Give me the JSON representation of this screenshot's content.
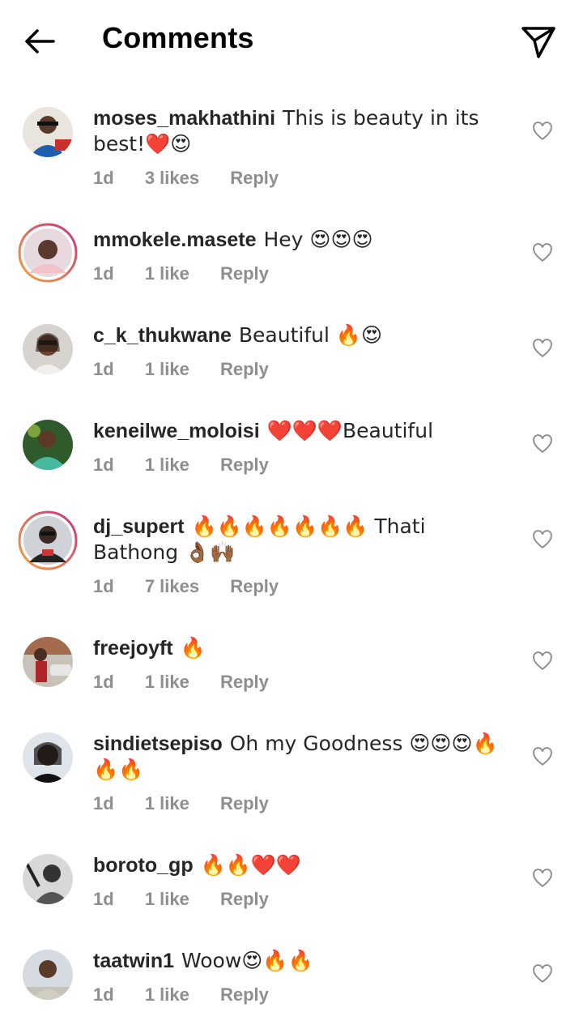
{
  "header": {
    "title": "Comments"
  },
  "comments": [
    {
      "username": "moses_makhathini",
      "text": "This is beauty in its best!❤️😍",
      "time": "1d",
      "likes": "3 likes",
      "reply": "Reply"
    },
    {
      "username": "mmokele.masete",
      "text": "Hey 😍😍😍",
      "time": "1d",
      "likes": "1 like",
      "reply": "Reply"
    },
    {
      "username": "c_k_thukwane",
      "text": "Beautiful 🔥😍",
      "time": "1d",
      "likes": "1 like",
      "reply": "Reply"
    },
    {
      "username": "keneilwe_moloisi",
      "text": "❤️❤️❤️Beautiful",
      "time": "1d",
      "likes": "1 like",
      "reply": "Reply"
    },
    {
      "username": "dj_supert",
      "text": "🔥🔥🔥🔥🔥🔥🔥 Thati Bathong 👌🏾🙌🏾",
      "time": "1d",
      "likes": "7 likes",
      "reply": "Reply"
    },
    {
      "username": "freejoyft",
      "text": "🔥",
      "time": "1d",
      "likes": "1 like",
      "reply": "Reply"
    },
    {
      "username": "sindietsepiso",
      "text": "Oh my Goodness 😍😍😍🔥🔥🔥",
      "time": "1d",
      "likes": "1 like",
      "reply": "Reply"
    },
    {
      "username": "boroto_gp",
      "text": "🔥🔥❤️❤️",
      "time": "1d",
      "likes": "1 like",
      "reply": "Reply"
    },
    {
      "username": "taatwin1",
      "text": "Woow😍🔥🔥",
      "time": "1d",
      "likes": "1 like",
      "reply": "Reply"
    }
  ],
  "icons": {
    "back": "arrow-left-icon",
    "send": "paper-plane-icon",
    "like": "heart-outline-icon"
  },
  "colors": {
    "story_ring_start": "#f9a13a",
    "story_ring_end": "#c13584",
    "meta_text": "#8e8e8e"
  }
}
